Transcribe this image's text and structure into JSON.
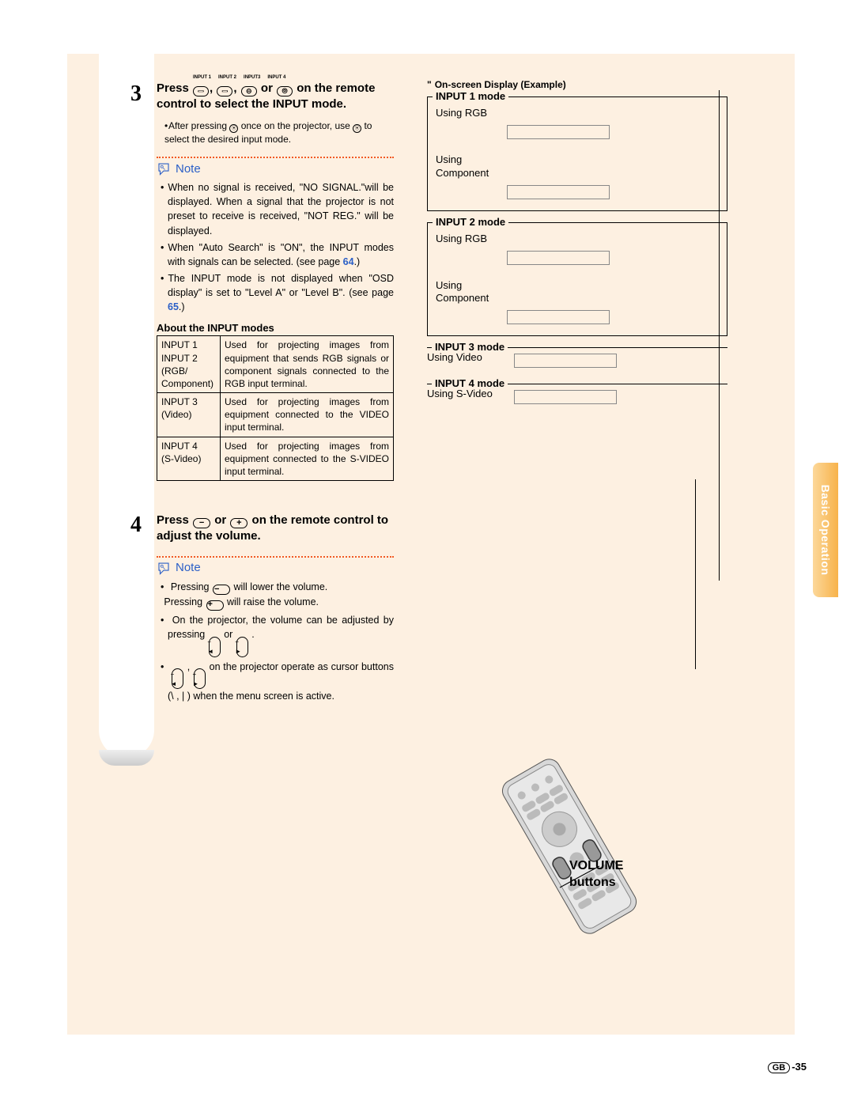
{
  "page": {
    "region": "GB",
    "number": "-35",
    "side_tab": "Basic Operation"
  },
  "step3": {
    "num": "3",
    "input_labels": [
      "INPUT 1",
      "INPUT 2",
      "INPUT3",
      "INPUT 4"
    ],
    "heading_a": "Press ",
    "heading_b": ", ",
    "heading_c": ", ",
    "heading_d": " or ",
    "heading_e": " on the remote control to select the INPUT mode.",
    "sub_a": "After pressing ",
    "sub_b": " once on the projector, use ",
    "sub_c": " to select the desired input mode.",
    "note_label": "Note",
    "notes": [
      {
        "text": "When no signal is received, \"NO SIGNAL.\"will be displayed. When a signal that the projector is not preset to receive is received, \"NOT REG.\" will be displayed."
      },
      {
        "text_a": "When \"Auto Search\" is \"ON\", the INPUT modes with signals can be selected. (see page ",
        "ref": "64",
        "text_b": ".)"
      },
      {
        "text_a": "The INPUT mode is not displayed when \"OSD display\" is set to \"Level A\" or \"Level B\". (see page ",
        "ref": "65",
        "text_b": ".)"
      }
    ],
    "table_title": "About the INPUT modes",
    "table": [
      {
        "c1": "INPUT 1\nINPUT 2\n(RGB/\nComponent)",
        "c2": "Used for projecting images from equipment that sends RGB signals or component signals connected to the RGB input terminal."
      },
      {
        "c1": "INPUT 3\n(Video)",
        "c2": "Used for projecting images from equipment connected to the VIDEO input terminal."
      },
      {
        "c1": "INPUT 4\n(S-Video)",
        "c2": "Used for projecting images from equipment connected to the S-VIDEO input terminal."
      }
    ]
  },
  "step4": {
    "num": "4",
    "heading_a": "Press ",
    "heading_b": " or ",
    "heading_c": " on the remote control to adjust the volume.",
    "note_label": "Note",
    "note1_a": "Pressing ",
    "note1_b": " will lower the volume.",
    "note1_c": "Pressing ",
    "note1_d": " will raise the volume.",
    "note2_a": "On the projector, the volume can be adjusted by pressing ",
    "note2_b": " or ",
    "note2_c": " .",
    "note3_a": " , ",
    "note3_b": " on the projector operate as cursor buttons (\\ , | ) when the menu screen is active."
  },
  "osd": {
    "title": "On-screen Display (Example)",
    "input1": {
      "legend": "INPUT 1 mode",
      "rgb": "Using RGB",
      "comp": "Using\nComponent"
    },
    "input2": {
      "legend": "INPUT 2 mode",
      "rgb": "Using RGB",
      "comp": "Using\nComponent"
    },
    "input3": {
      "legend": "INPUT 3 mode",
      "video": "Using Video"
    },
    "input4": {
      "legend": "INPUT 4 mode",
      "svideo": "Using S-Video"
    }
  },
  "figure": {
    "volume_label": "VOLUME\nbuttons"
  }
}
